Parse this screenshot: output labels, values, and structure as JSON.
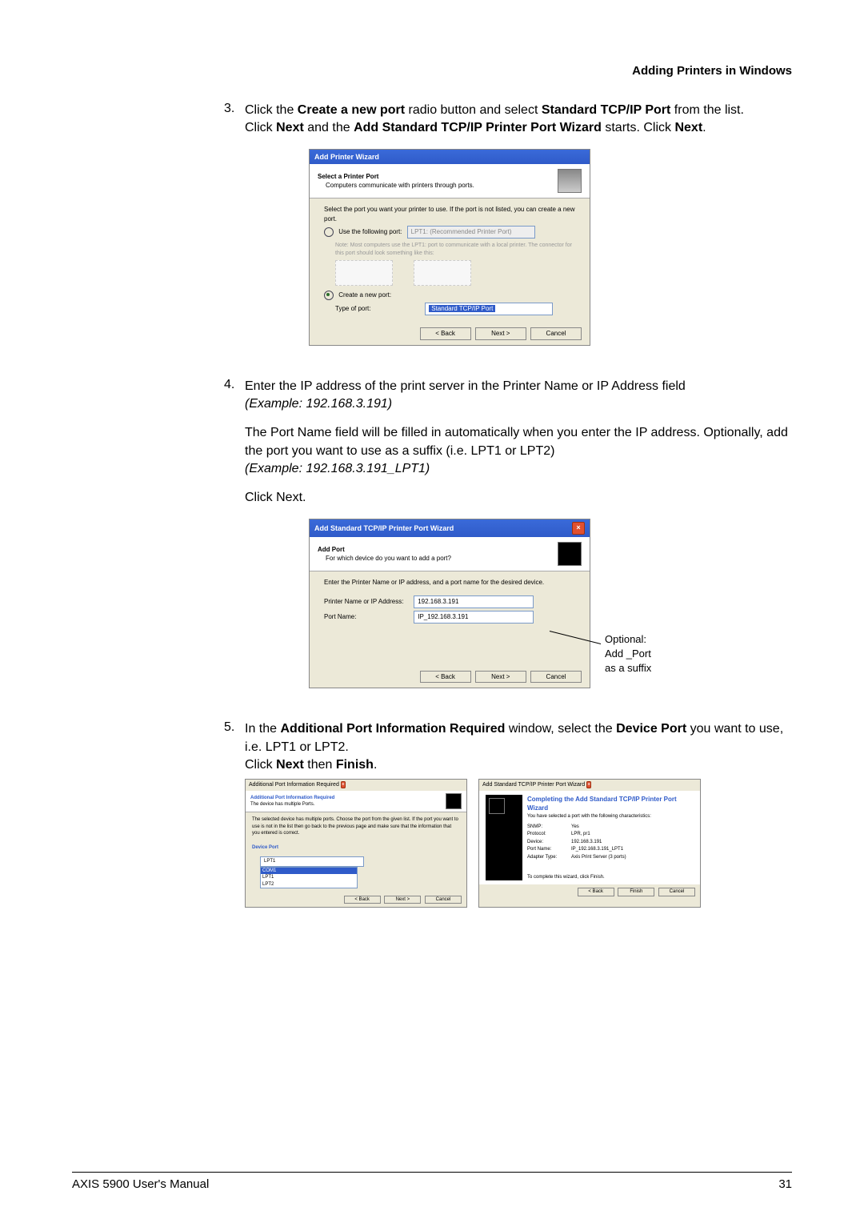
{
  "section_header": "Adding Printers in Windows",
  "steps": {
    "s3": {
      "num": "3.",
      "l1_a": "Click the ",
      "l1_b": "Create a new port",
      "l1_c": " radio button and select ",
      "l1_d": "Standard TCP/IP Port",
      "l1_e": " from the list.",
      "l2_a": "Click ",
      "l2_b": "Next",
      "l2_c": " and the ",
      "l2_d": "Add Standard TCP/IP Printer Port Wizard",
      "l2_e": " starts. Click ",
      "l2_f": "Next",
      "l2_g": "."
    },
    "s4": {
      "num": "4.",
      "l1": "Enter the IP address of the print server in the Printer Name or IP Address field",
      "ex1": "(Example: 192.168.3.191)",
      "l2": "The Port Name field will be filled in automatically when you enter the IP address. Optionally, add the port you want to use as a suffix (i.e. LPT1 or LPT2)",
      "ex2": "(Example: 192.168.3.191_LPT1)",
      "l3": "Click Next."
    },
    "s5": {
      "num": "5.",
      "l1_a": "In the ",
      "l1_b": "Additional Port Information Required",
      "l1_c": " window, select the ",
      "l1_d": "Device Port",
      "l1_e": " you want to use, i.e. LPT1 or LPT2.",
      "l2_a": "Click ",
      "l2_b": "Next",
      "l2_c": " then ",
      "l2_d": "Finish",
      "l2_e": "."
    }
  },
  "dlg1": {
    "title": "Add Printer Wizard",
    "hdr_bold": "Select a Printer Port",
    "hdr_sub": "Computers communicate with printers through ports.",
    "intro": "Select the port you want your printer to use. If the port is not listed, you can create a new port.",
    "use_label": "Use the following port:",
    "use_value": "LPT1: (Recommended Printer Port)",
    "note": "Note: Most computers use the LPT1: port to communicate with a local printer. The connector for this port should look something like this:",
    "create_label": "Create a new port:",
    "type_label": "Type of port:",
    "type_value": "Standard TCP/IP Port",
    "back": "< Back",
    "next": "Next >",
    "cancel": "Cancel"
  },
  "dlg2": {
    "title": "Add Standard TCP/IP Printer Port Wizard",
    "hdr_bold": "Add Port",
    "hdr_sub": "For which device do you want to add a port?",
    "intro": "Enter the Printer Name or IP address, and a port name for the desired device.",
    "addr_label": "Printer Name or IP Address:",
    "addr_value": "192.168.3.191",
    "port_label": "Port Name:",
    "port_value": "IP_192.168.3.191",
    "back": "< Back",
    "next": "Next >",
    "cancel": "Cancel"
  },
  "annotation": {
    "l1": "Optional:",
    "l2": "Add _Port",
    "l3": "as a suffix"
  },
  "dlg3": {
    "title": "Additional Port Information Required",
    "hdr_bold": "Additional Port Information Required",
    "hdr_sub": "The device has multiple Ports.",
    "intro": "The selected device has multiple ports. Choose the port from the given list. If the port you want to use is not in the list then go back to the previous page and make sure that the information that you entered is correct.",
    "device_port": "Device Port",
    "sel": "LPT1",
    "opt1": "COM1",
    "opt2": "LPT1",
    "opt3": "LPT2",
    "back": "< Back",
    "next": "Next >",
    "cancel": "Cancel"
  },
  "dlg4": {
    "title": "Add Standard TCP/IP Printer Port Wizard",
    "hdr_bold": "Completing the Add Standard TCP/IP Printer Port Wizard",
    "hdr_sub": "You have selected a port with the following characteristics:",
    "kv": {
      "snmp_k": "SNMP:",
      "snmp_v": "Yes",
      "proto_k": "Protocol:",
      "proto_v": "LPR, pr1",
      "dev_k": "Device:",
      "dev_v": "192.168.3.191",
      "port_k": "Port Name:",
      "port_v": "IP_192.168.3.191_LPT1",
      "adap_k": "Adapter Type:",
      "adap_v": "Axis Print Server (3 ports)"
    },
    "complete": "To complete this wizard, click Finish.",
    "back": "< Back",
    "finish": "Finish",
    "cancel": "Cancel"
  },
  "footer": {
    "left": "AXIS 5900 User's Manual",
    "right": "31"
  }
}
